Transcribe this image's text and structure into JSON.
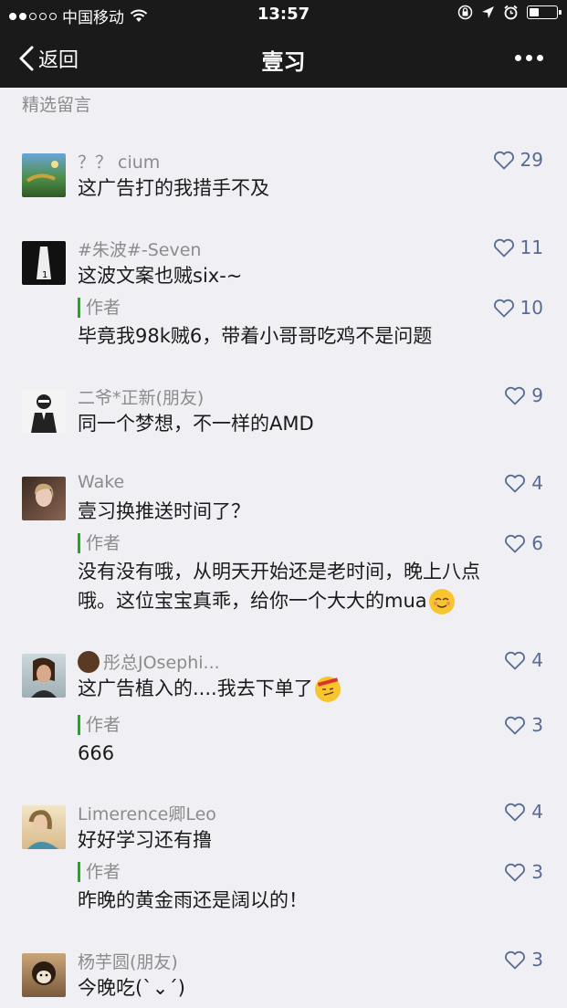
{
  "status": {
    "carrier": "中国移动",
    "time": "13:57"
  },
  "nav": {
    "back": "返回",
    "title": "壹习"
  },
  "section_title": "精选留言",
  "comments": [
    {
      "name": "？？ cium",
      "text": "这广告打的我措手不及",
      "likes": "29"
    },
    {
      "name": "#朱波#-Seven",
      "text": "这波文案也贼six-~",
      "likes": "11",
      "reply": {
        "label": "作者",
        "text": "毕竟我98k贼6，带着小哥哥吃鸡不是问题",
        "likes": "10"
      }
    },
    {
      "name": "二爷*正新(朋友)",
      "text": "同一个梦想，不一样的AMD",
      "likes": "9"
    },
    {
      "name": "Wake",
      "text": "壹习换推送时间了？",
      "likes": "4",
      "reply": {
        "label": "作者",
        "text": "没有没有哦，从明天开始还是老时间，晚上八点哦。这位宝宝真乖，给你一个大大的mua",
        "likes": "6"
      }
    },
    {
      "name": "彤总JOsephi...",
      "text": "这广告植入的....我去下单了",
      "likes": "4",
      "reply": {
        "label": "作者",
        "text": "666",
        "likes": "3"
      }
    },
    {
      "name": "Limerence卿Leo",
      "text": "好好学习还有撸",
      "likes": "4",
      "reply": {
        "label": "作者",
        "text": "昨晚的黄金雨还是阔以的！",
        "likes": "3"
      }
    },
    {
      "name": "杨芋圆(朋友)",
      "text": "今晚吃(`⌄´)",
      "likes": "3"
    }
  ],
  "colors": {
    "accent": "#576b95",
    "author_bar": "#1aad19",
    "nav_bg": "#1a1a1a"
  }
}
